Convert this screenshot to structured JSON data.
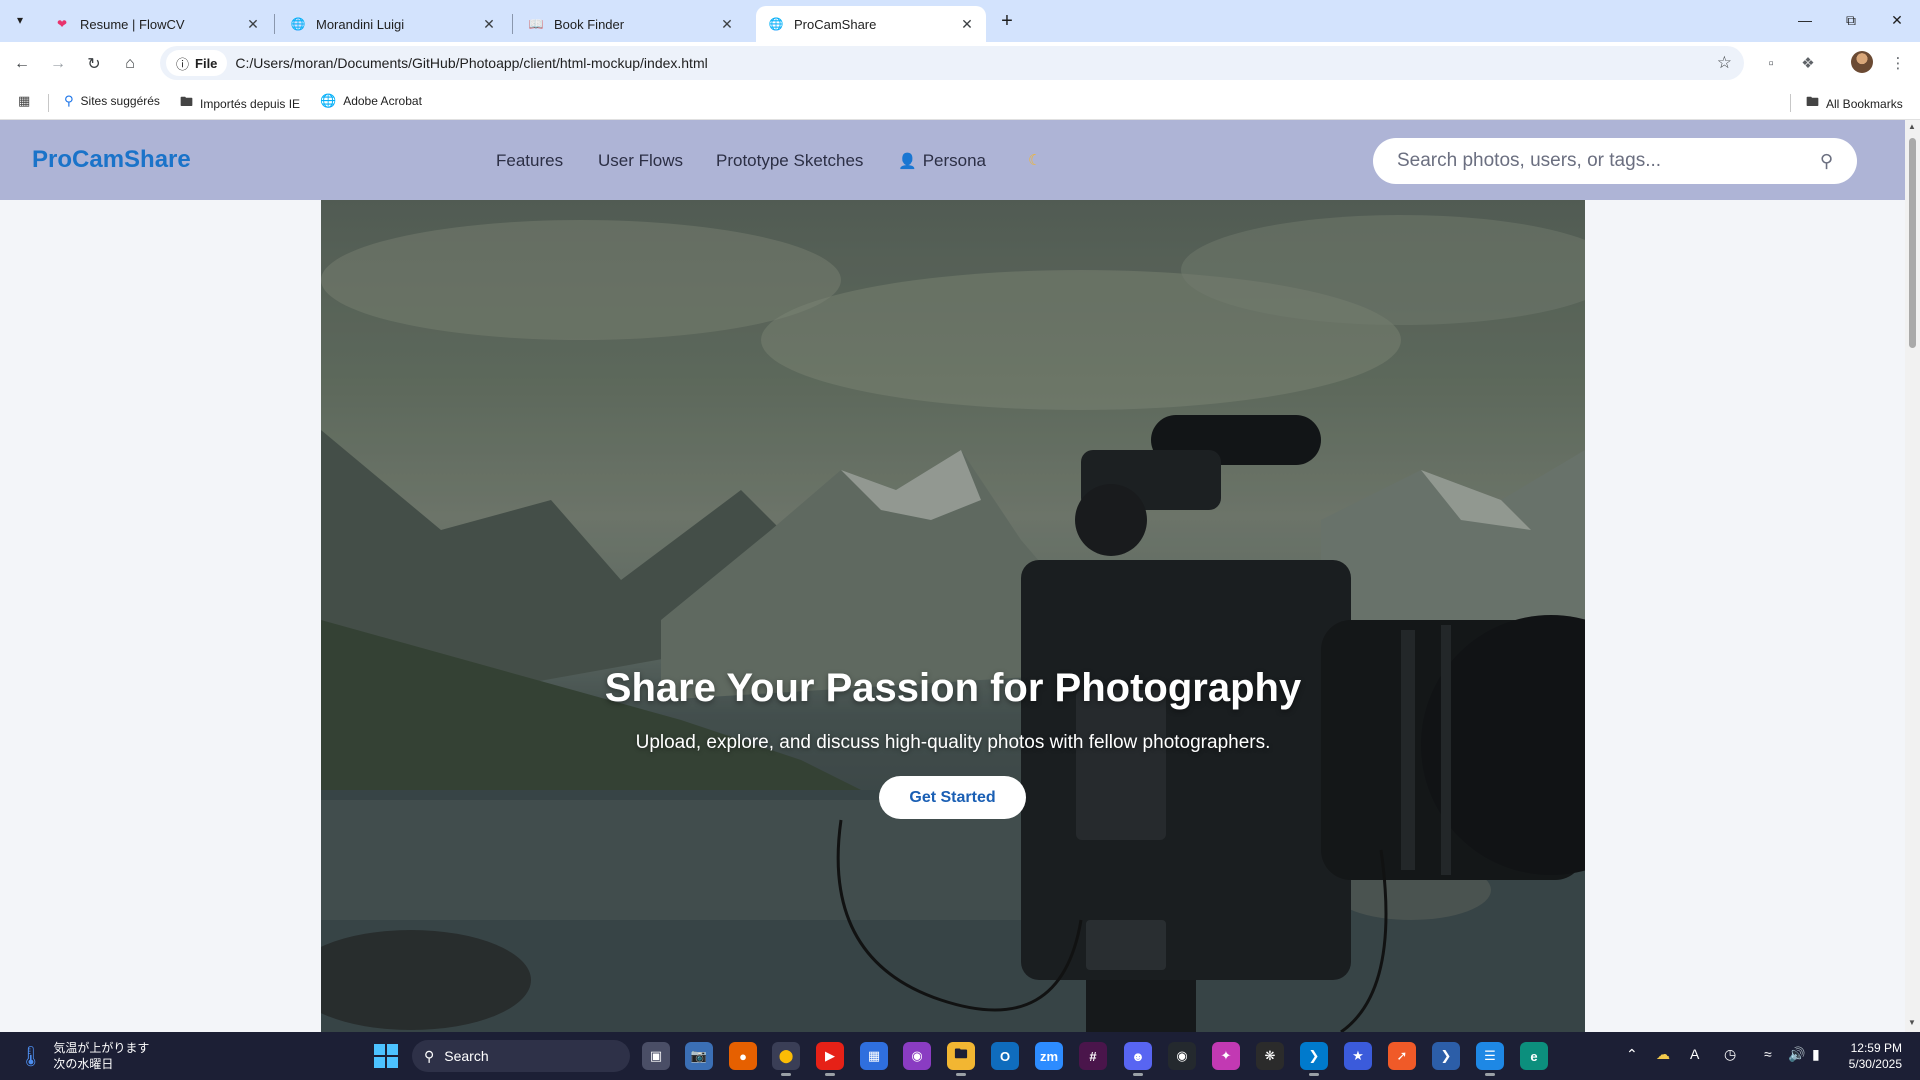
{
  "browser": {
    "tabs": [
      {
        "title": "Resume | FlowCV",
        "favicon": "flowcv-icon"
      },
      {
        "title": "Morandini Luigi",
        "favicon": "globe-icon"
      },
      {
        "title": "Book Finder",
        "favicon": "book-icon"
      },
      {
        "title": "ProCamShare",
        "favicon": "globe-icon",
        "active": true
      }
    ],
    "address": {
      "chip": "File",
      "url": "C:/Users/moran/Documents/GitHub/Photoapp/client/html-mockup/index.html"
    },
    "bookmarks": [
      {
        "label": "Sites suggérés"
      },
      {
        "label": "Importés depuis IE"
      },
      {
        "label": "Adobe Acrobat"
      }
    ],
    "all_bookmarks": "All Bookmarks"
  },
  "app": {
    "brand": "ProCamShare",
    "nav": {
      "features": "Features",
      "user_flows": "User Flows",
      "prototype_sketches": "Prototype Sketches",
      "persona": "Persona"
    },
    "search_placeholder": "Search photos, users, or tags...",
    "hero": {
      "title": "Share Your Passion for Photography",
      "subtitle": "Upload, explore, and discuss high-quality photos with fellow photographers.",
      "cta": "Get Started"
    }
  },
  "taskbar": {
    "weather_line1": "気温が上がります",
    "weather_line2": "次の水曜日",
    "search_label": "Search",
    "time": "12:59 PM",
    "date": "5/30/2025"
  },
  "colors": {
    "tabstrip": "#d3e3fd",
    "app_header": "#aeb4d6",
    "brand": "#1a73c9",
    "cta_text": "#1a5fb4",
    "taskbar": "#1c1f35"
  }
}
